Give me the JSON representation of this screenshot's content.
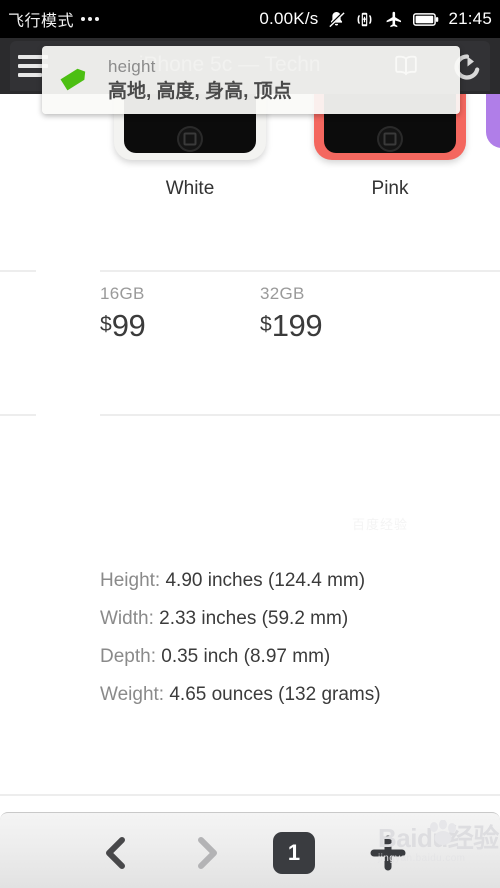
{
  "status_bar": {
    "mode_label": "飞行模式",
    "dots": "•••",
    "network_speed": "0.00K/s",
    "time": "21:45",
    "icons": [
      "bell-muted-icon",
      "vibrate-icon",
      "airplane-mode-icon",
      "battery-icon"
    ]
  },
  "browser": {
    "menu_icon": "hamburger-menu-icon",
    "page_title": "— iPhone 5c — Techn",
    "reader_icon": "open-book-icon",
    "reload_icon": "reload-icon"
  },
  "translation_popup": {
    "tag_icon": "green-tag-icon",
    "word": "height",
    "translations": "高地, 高度, 身高, 顶点"
  },
  "page": {
    "products": [
      {
        "label": "White",
        "color_hex": "#f3f3f1"
      },
      {
        "label": "Pink",
        "color_hex": "#f4675f"
      }
    ],
    "partial_product_color_hex": "#b07ee8",
    "prices": [
      {
        "capacity": "16GB",
        "currency": "$",
        "amount": "99"
      },
      {
        "capacity": "32GB",
        "currency": "$",
        "amount": "199"
      }
    ],
    "specs": [
      {
        "label": "Height:",
        "value": "4.90 inches (124.4 mm)"
      },
      {
        "label": "Width:",
        "value": "2.33 inches (59.2 mm)"
      },
      {
        "label": "Depth:",
        "value": "0.35 inch (8.97 mm)"
      },
      {
        "label": "Weight:",
        "value": "4.65 ounces (132 grams)"
      }
    ],
    "watermark_faint": "百度经验"
  },
  "bottom_nav": {
    "back_icon": "chevron-left-icon",
    "forward_icon": "chevron-right-icon",
    "tab_count": "1",
    "add_icon": "plus-icon"
  },
  "watermark": {
    "brand": "Baidu经验",
    "url": "jingyan.baidu.com",
    "paw_icon": "paw-print-icon"
  }
}
